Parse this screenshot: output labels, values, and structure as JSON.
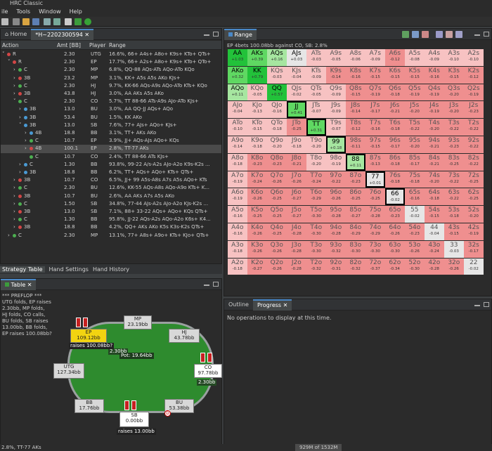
{
  "app": {
    "title": "HRC Classic"
  },
  "menu": [
    "ile",
    "Tools",
    "Window",
    "Help"
  ],
  "left_tabs": {
    "home": "Home",
    "hand": "*H~2202300594"
  },
  "tree": {
    "headers": {
      "action": "Action",
      "amt": "Amt [BB]",
      "player": "Player",
      "range": "Range"
    },
    "rows": [
      {
        "action": "R",
        "amt": "2.30",
        "player": "UTG",
        "range": "16.6%, 66+ A4s+ A8o+ K9s+ KTo+ QTs+",
        "dot": "#d24646",
        "exp": "v",
        "ind": 0
      },
      {
        "action": "R",
        "amt": "2.30",
        "player": "EP",
        "range": "17.7%, 66+ A2s+ A8o+ K9s+ KTo+ QTo+",
        "dot": "#d24646",
        "exp": "v",
        "ind": 1
      },
      {
        "action": "C",
        "amt": "2.30",
        "player": "MP",
        "range": "6.8%, QQ-88 AQs-ATs AQo-ATo KQo",
        "dot": "#4caf50",
        "exp": ">",
        "ind": 2
      },
      {
        "action": "3B",
        "amt": "23.2",
        "player": "MP",
        "range": "3.1%, KK+ A5s A5s AKo KJs+",
        "dot": "#d24646",
        "exp": ">",
        "ind": 2
      },
      {
        "action": "C",
        "amt": "2.30",
        "player": "HJ",
        "range": "9.7%, KK-66 AQs-A9s AQo-ATo KTs+ KQo",
        "dot": "#4caf50",
        "exp": ">",
        "ind": 2
      },
      {
        "action": "3B",
        "amt": "43.8",
        "player": "HJ",
        "range": "3.0%, AA AKs A5s AKo",
        "dot": "#d24646",
        "exp": ">",
        "ind": 2
      },
      {
        "action": "C",
        "amt": "2.30",
        "player": "CO",
        "range": "5.7%, TT 88-66 ATs-A9s AJo-ATo KJs+",
        "dot": "#4caf50",
        "exp": "v",
        "ind": 2
      },
      {
        "action": "3B",
        "amt": "13.0",
        "player": "BU",
        "range": "3.0%, AA QQ-JJ AQs+ AQo",
        "dot": "#4a9ad4",
        "exp": ">",
        "ind": 3
      },
      {
        "action": "3B",
        "amt": "53.4",
        "player": "BU",
        "range": "1.5%, KK AKo",
        "dot": "#4a9ad4",
        "exp": ">",
        "ind": 3
      },
      {
        "action": "3B",
        "amt": "13.0",
        "player": "SB",
        "range": "7.6%, 77+ AJs+ AQo+ KJs+",
        "dot": "#4a9ad4",
        "exp": "v",
        "ind": 3
      },
      {
        "action": "4B",
        "amt": "18.8",
        "player": "BB",
        "range": "3.1%, TT+ AKs AKo",
        "dot": "#4a9ad4",
        "exp": ">",
        "ind": 4
      },
      {
        "action": "C",
        "amt": "10.7",
        "player": "EP",
        "range": "3.9%, JJ+ AQs-AJs AQo+ KQs",
        "dot": "#4caf50",
        "exp": ">",
        "ind": 4
      },
      {
        "action": "4B",
        "amt": "100.1",
        "player": "EP",
        "range": "2.8%, TT-77 AKs",
        "dot": "#d24646",
        "exp": ">",
        "ind": 4,
        "sel": true
      },
      {
        "action": "C",
        "amt": "10.7",
        "player": "CO",
        "range": "2.4%, TT 88-66 ATs KJs+",
        "dot": "#4caf50",
        "exp": "",
        "ind": 4
      },
      {
        "action": "C",
        "amt": "1.30",
        "player": "BB",
        "range": "93.8%, 99-22 A/s-A2s AJo-A2o K9s-K2s ...",
        "dot": "#4a9ad4",
        "exp": ">",
        "ind": 3
      },
      {
        "action": "3B",
        "amt": "18.8",
        "player": "BB",
        "range": "6.2%, TT+ AQs+ AQo+ KTs+ QTs+",
        "dot": "#4a9ad4",
        "exp": ">",
        "ind": 3
      },
      {
        "action": "3B",
        "amt": "10.7",
        "player": "CO",
        "range": "6.5%, JJ+ 99 A5s-A8s A7s A5s AQo+ KTs",
        "dot": "#d24646",
        "exp": ">",
        "ind": 2
      },
      {
        "action": "C",
        "amt": "2.30",
        "player": "BU",
        "range": "12.6%, KK-55 AQs-A8s AQo-A9o KTs+ K...",
        "dot": "#4caf50",
        "exp": ">",
        "ind": 2
      },
      {
        "action": "3B",
        "amt": "10.7",
        "player": "BU",
        "range": "2.6%, AA AKs A7s A5s AKo",
        "dot": "#d24646",
        "exp": ">",
        "ind": 2
      },
      {
        "action": "C",
        "amt": "1.50",
        "player": "SB",
        "range": "34.8%, 77-44 AJs-A2s AJo-A2o KJs-K2s ...",
        "dot": "#4caf50",
        "exp": ">",
        "ind": 2
      },
      {
        "action": "3B",
        "amt": "13.0",
        "player": "SB",
        "range": "7.1%, 88+ 33-22 AQs+ AQo+ KQs QTs+",
        "dot": "#d24646",
        "exp": ">",
        "ind": 2
      },
      {
        "action": "C",
        "amt": "1.30",
        "player": "BB",
        "range": "95.8%, JJ-22 AQs-A2s AQo-A2o K6s+ K4...",
        "dot": "#4caf50",
        "exp": ">",
        "ind": 2
      },
      {
        "action": "3B",
        "amt": "18.8",
        "player": "BB",
        "range": "4.2%, QQ+ AKs AKo K5s K3s-K2s QTs+",
        "dot": "#d24646",
        "exp": ">",
        "ind": 2
      },
      {
        "action": "C",
        "amt": "2.30",
        "player": "MP",
        "range": "13.1%, 77+ A8s+ A9o+ KTs+ KJo+ QTs+",
        "dot": "#4caf50",
        "exp": ">",
        "ind": 1
      }
    ]
  },
  "bottom_tabs": [
    "Strategy Table",
    "Hand Settings",
    "Hand History"
  ],
  "table_panel": {
    "tab": "Table",
    "log": [
      "*** PREFLOP ***",
      "UTG folds, EP raises",
      "2.30bb, MP folds,",
      "HJ folds, CO calls,",
      "BU folds, SB raises",
      "13.00bb, BB folds,",
      "EP raises 100.08bb?"
    ],
    "seats": {
      "mp": {
        "name": "MP",
        "stack": "23.19bb"
      },
      "hj": {
        "name": "HJ",
        "stack": "43.78bb"
      },
      "co": {
        "name": "CO",
        "stack": "97.78bb",
        "bet": "2.30bb"
      },
      "bu": {
        "name": "BU",
        "stack": "53.38bb"
      },
      "sb": {
        "name": "SB",
        "stack": "0.00bb",
        "action": "raises 13.00bb"
      },
      "bb": {
        "name": "BB",
        "stack": "17.76bb"
      },
      "utg": {
        "name": "UTG",
        "stack": "127.34bb"
      },
      "ep": {
        "name": "EP",
        "stack": "109.12bb",
        "action": "raises 100.08bb?"
      }
    },
    "pot_bet": "2.30bb",
    "pot": "Pot: 19.64bb",
    "dealer": "D"
  },
  "range_panel": {
    "tab": "Range",
    "title": "EP 4bets 100.08bb against CO, SB: 2.8%",
    "colors": {
      "positive_strong": "#22c23a",
      "positive_mid": "#5fd862",
      "positive_light": "#a6e6a0",
      "negative_strong": "#ef8f8f",
      "negative_light": "#f7c2c2",
      "neutral": "#e6e6e6",
      "outside": "#f6d9d9"
    },
    "cells": [
      [
        "AA",
        "+1.03",
        "AKs",
        "+0.39",
        "AQs",
        "+0.16",
        "AJs",
        "+0.03",
        "ATs",
        "-0.03",
        "A9s",
        "-0.05",
        "A8s",
        "-0.06",
        "A7s",
        "-0.09",
        "A6s",
        "-0.12",
        "A5s",
        "-0.08",
        "A4s",
        "-0.09",
        "A3s",
        "-0.10",
        "A2s",
        "-0.10"
      ],
      [
        "AKo",
        "+0.32",
        "KK",
        "+0.79",
        "KQs",
        "-0.03",
        "KJs",
        "-0.04",
        "KTs",
        "-0.09",
        "K9s",
        "-0.14",
        "K8s",
        "-0.16",
        "K7s",
        "-0.15",
        "K6s",
        "-0.15",
        "K5s",
        "-0.15",
        "K4s",
        "-0.16",
        "K3s",
        "-0.15",
        "K2s",
        "-0.12"
      ],
      [
        "AQo",
        "+0.11",
        "KQo",
        "-0.05",
        "QQ",
        "+0.57",
        "QJs",
        "-0.02",
        "QTs",
        "-0.05",
        "Q9s",
        "-0.09",
        "Q8s",
        "-0.15",
        "Q7s",
        "-0.19",
        "Q6s",
        "-0.18",
        "Q5s",
        "-0.19",
        "Q4s",
        "-0.19",
        "Q3s",
        "-0.20",
        "Q2s",
        "-0.19"
      ],
      [
        "AJo",
        "-0.04",
        "KJo",
        "-0.13",
        "QJo",
        "-0.16",
        "JJ",
        "+0.41",
        "JTs",
        "-0.07",
        "J9s",
        "-0.09",
        "J8s",
        "-0.14",
        "J7s",
        "-0.17",
        "J6s",
        "-0.21",
        "J5s",
        "-0.20",
        "J4s",
        "-0.19",
        "J3s",
        "-0.20",
        "J2s",
        "-0.23"
      ],
      [
        "ATo",
        "-0.10",
        "KTo",
        "-0.15",
        "QTo",
        "-0.18",
        "JTo",
        "-0.25",
        "TT",
        "+0.31",
        "T9s",
        "-0.07",
        "T8s",
        "-0.12",
        "T7s",
        "-0.16",
        "T6s",
        "-0.18",
        "T5s",
        "-0.22",
        "T4s",
        "-0.20",
        "T3s",
        "-0.22",
        "T2s",
        "-0.22"
      ],
      [
        "A9o",
        "-0.14",
        "K9o",
        "-0.18",
        "Q9o",
        "-0.20",
        "J9o",
        "-0.18",
        "T9o",
        "-0.20",
        "99",
        "+0.18",
        "98s",
        "-0.11",
        "97s",
        "-0.15",
        "96s",
        "-0.17",
        "95s",
        "-0.20",
        "94s",
        "-0.21",
        "93s",
        "-0.23",
        "92s",
        "-0.22"
      ],
      [
        "A8o",
        "-0.18",
        "K8o",
        "-0.23",
        "Q8o",
        "-0.23",
        "J8o",
        "-0.21",
        "T8o",
        "-0.20",
        "98o",
        "-0.19",
        "88",
        "+0.11",
        "87s",
        "-0.13",
        "86s",
        "-0.18",
        "85s",
        "-0.17",
        "84s",
        "-0.21",
        "83s",
        "-0.25",
        "82s",
        "-0.22"
      ],
      [
        "A7o",
        "-0.19",
        "K7o",
        "-0.24",
        "Q7o",
        "-0.26",
        "J7o",
        "-0.26",
        "T7o",
        "-0.24",
        "97o",
        "-0.22",
        "87o",
        "-0.23",
        "77",
        "+0.01",
        "76s",
        "-0.18",
        "75s",
        "-0.18",
        "74s",
        "-0.20",
        "73s",
        "-0.22",
        "72s",
        "-0.25"
      ],
      [
        "A6o",
        "-0.19",
        "K6o",
        "-0.26",
        "Q6o",
        "-0.25",
        "J6o",
        "-0.27",
        "T6o",
        "-0.29",
        "96o",
        "-0.26",
        "86o",
        "-0.25",
        "76o",
        "-0.25",
        "66",
        "-0.02",
        "65s",
        "-0.16",
        "64s",
        "-0.18",
        "63s",
        "-0.22",
        "62s",
        "-0.25"
      ],
      [
        "A5o",
        "-0.16",
        "K5o",
        "-0.25",
        "Q5o",
        "-0.25",
        "J5o",
        "-0.27",
        "T5o",
        "-0.30",
        "95o",
        "-0.28",
        "85o",
        "-0.27",
        "75o",
        "-0.28",
        "65o",
        "-0.23",
        "55",
        "-0.02",
        "54s",
        "-0.15",
        "53s",
        "-0.18",
        "52s",
        "-0.20"
      ],
      [
        "A4o",
        "-0.16",
        "K4o",
        "-0.26",
        "Q4o",
        "-0.25",
        "J4o",
        "-0.28",
        "T4o",
        "-0.30",
        "94o",
        "-0.28",
        "84o",
        "-0.29",
        "74o",
        "-0.29",
        "64o",
        "-0.26",
        "54o",
        "-0.23",
        "44",
        "-0.04",
        "43s",
        "-0.15",
        "42s",
        "-0.19"
      ],
      [
        "A3o",
        "-0.18",
        "K3o",
        "-0.26",
        "Q3o",
        "-0.26",
        "J3o",
        "-0.28",
        "T3o",
        "-0.30",
        "93o",
        "-0.32",
        "83o",
        "-0.30",
        "73o",
        "-0.30",
        "63o",
        "-0.30",
        "53o",
        "-0.26",
        "43o",
        "-0.24",
        "33",
        "-0.03",
        "32s",
        "-0.17"
      ],
      [
        "A2o",
        "-0.18",
        "K2o",
        "-0.27",
        "Q2o",
        "-0.26",
        "J2o",
        "-0.28",
        "T2o",
        "-0.32",
        "92o",
        "-0.31",
        "82o",
        "-0.32",
        "72o",
        "-0.37",
        "62o",
        "-0.34",
        "52o",
        "-0.30",
        "42o",
        "-0.28",
        "32o",
        "-0.26",
        "22",
        "-0.02"
      ]
    ],
    "in_range": [
      "AA",
      "AKs",
      "AQs",
      "AJs",
      "AKo",
      "KK",
      "AQo",
      "QQ",
      "JJ",
      "TT",
      "99",
      "88",
      "77",
      "66"
    ]
  },
  "progress_panel": {
    "tabs": {
      "outline": "Outline",
      "progress": "Progress"
    },
    "message": "No operations to display at this time."
  },
  "status": {
    "left": "2.8%, TT-77 AKs",
    "mem": "929M of 1532M"
  }
}
